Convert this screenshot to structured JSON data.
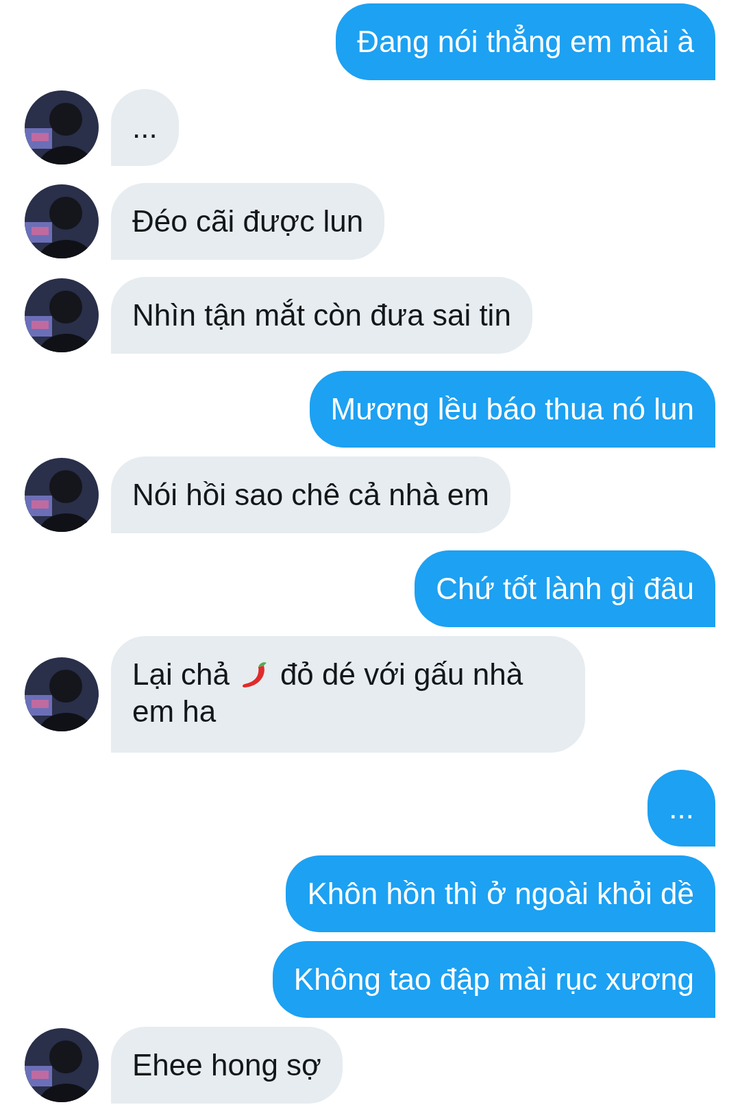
{
  "messages": [
    {
      "kind": "sent",
      "text": "Đang nói thẳng em mài à"
    },
    {
      "kind": "received",
      "text": "..."
    },
    {
      "kind": "received",
      "text": "Đéo cãi được lun"
    },
    {
      "kind": "received",
      "text": "Nhìn tận mắt còn đưa sai tin"
    },
    {
      "kind": "sent",
      "text": "Mương lều báo thua nó lun"
    },
    {
      "kind": "received",
      "text": "Nói hồi sao chê cả nhà em"
    },
    {
      "kind": "sent",
      "text": "Chứ tốt lành gì đâu"
    },
    {
      "kind": "received",
      "lines": [
        [
          {
            "kind": "text",
            "text": "Lại chả"
          },
          {
            "kind": "pepper"
          },
          {
            "kind": "text",
            "text": "đỏ dé với gấu nhà"
          }
        ],
        [
          {
            "kind": "text",
            "text": "em ha"
          }
        ]
      ]
    },
    {
      "kind": "sent",
      "text": "..."
    },
    {
      "kind": "sent",
      "text": "Khôn hồn thì ở ngoài khỏi dề"
    },
    {
      "kind": "sent",
      "text": "Không tao đập mài rục xương"
    },
    {
      "kind": "received",
      "text": "Ehee hong sợ"
    }
  ]
}
